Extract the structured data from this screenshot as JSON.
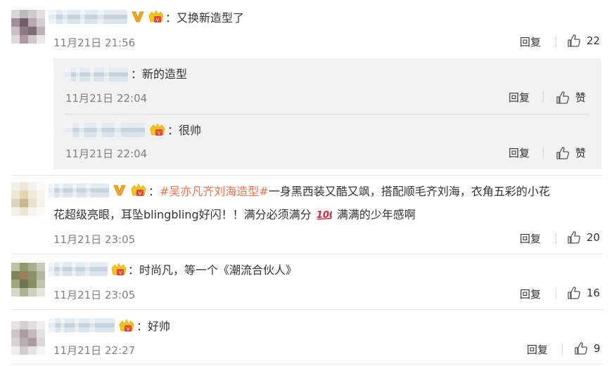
{
  "comments": [
    {
      "text_suffix": "：又换新造型了",
      "time": "11月21日 21:56",
      "reply_label": "回复",
      "like_count": "22",
      "replies": [
        {
          "text_suffix": "：新的造型",
          "time": "11月21日 22:04",
          "reply_label": "回复",
          "like_label": "赞"
        },
        {
          "text_suffix": "：很帅",
          "time": "11月21日 22:04",
          "reply_label": "回复",
          "like_label": "赞"
        }
      ]
    },
    {
      "topic": "#吴亦凡齐刘海造型#",
      "text_line1": "一身黑西装又酷又飒，搭配顺毛齐刘海，衣角五彩的小花",
      "text_line2_a": "花超级亮眼，耳坠blingbling好闪！！满分必须满分",
      "text_line2_b": "满满的少年感啊",
      "time": "11月21日 23:05",
      "reply_label": "回复",
      "like_count": "20"
    },
    {
      "text_suffix": "：时尚凡，等一个《潮流合伙人》",
      "time": "11月21日 23:05",
      "reply_label": "回复",
      "like_count": "16"
    },
    {
      "text_suffix": "：好帅",
      "time": "11月21日 22:27",
      "reply_label": "回复",
      "like_count": "9"
    }
  ],
  "colors": {
    "topic": "#eb7350",
    "text": "#333333",
    "time": "#808080",
    "reply_bg": "#f2f2f2"
  },
  "icons": [
    "verified-v-icon",
    "crown-badge-icon",
    "thumbs-up-icon",
    "hundred-points-emoji"
  ]
}
